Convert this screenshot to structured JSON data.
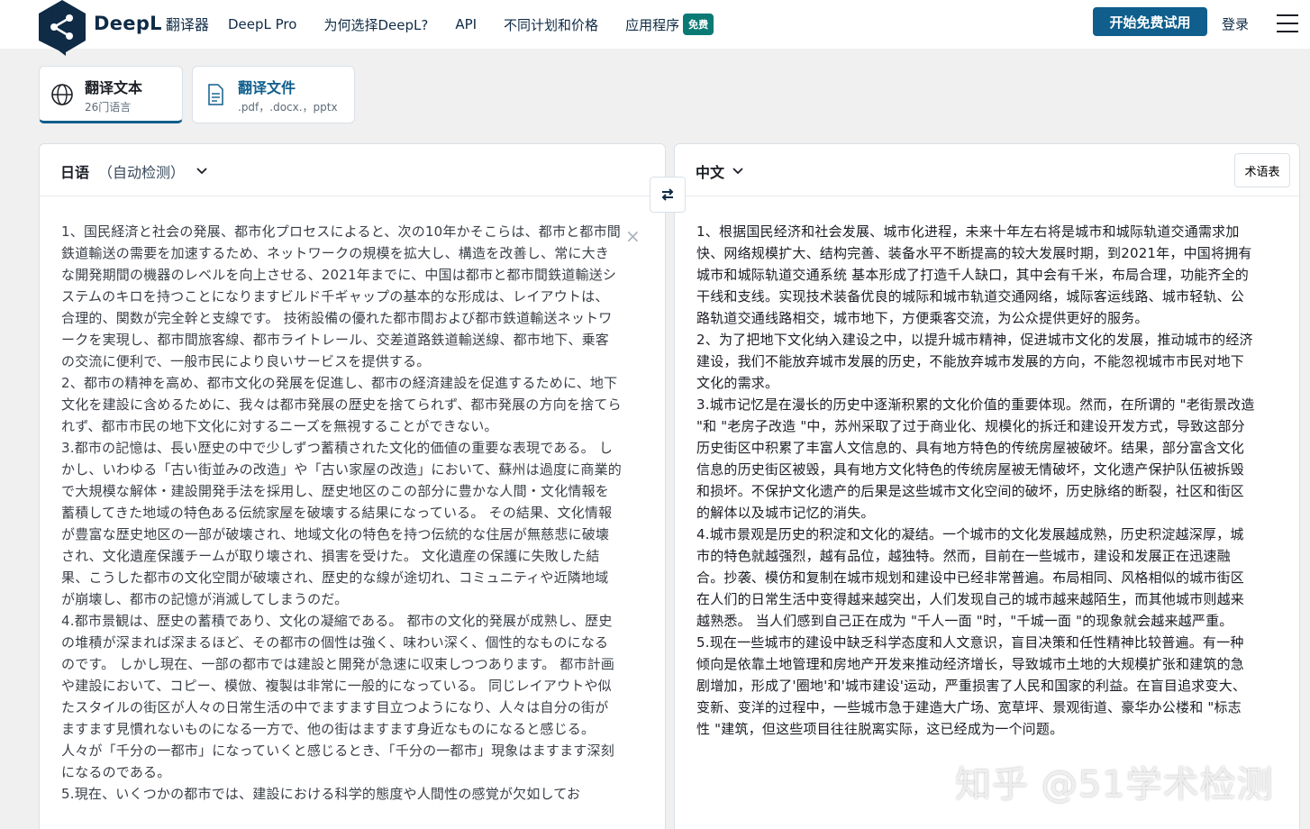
{
  "header": {
    "brand_name": "DeepL",
    "brand_sub": "翻译器",
    "nav": [
      {
        "label": "DeepL Pro"
      },
      {
        "label": "为何选择DeepL?"
      },
      {
        "label": "API"
      },
      {
        "label": "不同计划和价格"
      },
      {
        "label": "应用程序",
        "badge": "免费"
      }
    ],
    "cta_label": "开始免费试用",
    "login_label": "登录"
  },
  "modes": {
    "text": {
      "title": "翻译文本",
      "subtitle": "26门语言",
      "icon": "globe-icon"
    },
    "file": {
      "title": "翻译文件",
      "subtitle": ".pdf，.docx.，pptx",
      "icon": "document-icon"
    }
  },
  "source": {
    "language": "日语",
    "detect_label": "（自动检测）",
    "clear_symbol": "×",
    "paragraphs": [
      "1、国民経済と社会の発展、都市化プロセスによると、次の10年かそこらは、都市と都市間鉄道輸送の需要を加速するため、ネットワークの規模を拡大し、構造を改善し、常に大きな開発期間の機器のレベルを向上させる、2021年までに、中国は都市と都市間鉄道輸送システムのキロを持つことになりますビルド千ギャップの基本的な形成は、レイアウトは、合理的、関数が完全幹と支線です。 技術設備の優れた都市間および都市鉄道輸送ネットワークを実現し、都市間旅客線、都市ライトレール、交差道路鉄道輸送線、都市地下、乗客の交流に便利で、一般市民により良いサービスを提供する。",
      "2、都市の精神を高め、都市文化の発展を促進し、都市の経済建設を促進するために、地下文化を建設に含めるために、我々は都市発展の歴史を捨てられず、都市発展の方向を捨てられず、都市市民の地下文化に対するニーズを無視することができない。",
      "3.都市の記憶は、長い歴史の中で少しずつ蓄積された文化的価値の重要な表現である。 しかし、いわゆる「古い街並みの改造」や「古い家屋の改造」において、蘇州は過度に商業的で大規模な解体・建設開発手法を採用し、歴史地区のこの部分に豊かな人間・文化情報を蓄積してきた地域の特色ある伝統家屋を破壊する結果になっている。 その結果、文化情報が豊富な歴史地区の一部が破壊され、地域文化の特色を持つ伝統的な住居が無慈悲に破壊され、文化遺産保護チームが取り壊され、損害を受けた。 文化遺産の保護に失敗した結果、こうした都市の文化空間が破壊され、歴史的な線が途切れ、コミュニティや近隣地域が崩壊し、都市の記憶が消滅してしまうのだ。",
      "4.都市景観は、歴史の蓄積であり、文化の凝縮である。 都市の文化的発展が成熟し、歴史の堆積が深まれば深まるほど、その都市の個性は強く、味わい深く、個性的なものになるのです。 しかし現在、一部の都市では建設と開発が急速に収束しつつあります。 都市計画や建設において、コピー、模倣、複製は非常に一般的になっている。 同じレイアウトや似たスタイルの街区が人々の日常生活の中でますます目立つようになり、人々は自分の街がますます見慣れないものになる一方で、他の街はますます身近なものになると感じる。人々が「千分の一都市」になっていくと感じるとき、「千分の一都市」現象はますます深刻になるのである。",
      "5.現在、いくつかの都市では、建設における科学的態度や人間性の感覚が欠如してお"
    ]
  },
  "target": {
    "language": "中文",
    "glossary_label": "术语表",
    "paragraphs": [
      "1、根据国民经济和社会发展、城市化进程，未来十年左右将是城市和城际轨道交通需求加快、网络规模扩大、结构完善、装备水平不断提高的较大发展时期，到2021年，中国将拥有城市和城际轨道交通系统 基本形成了打造千人缺口，其中会有千米，布局合理，功能齐全的干线和支线。实现技术装备优良的城际和城市轨道交通网络，城际客运线路、城市轻轨、公路轨道交通线路相交，城市地下，方便乘客交流，为公众提供更好的服务。",
      "2、为了把地下文化纳入建设之中，以提升城市精神，促进城市文化的发展，推动城市的经济建设，我们不能放弃城市发展的历史，不能放弃城市发展的方向，不能忽视城市市民对地下文化的需求。",
      "3.城市记忆是在漫长的历史中逐渐积累的文化价值的重要体现。然而，在所谓的 \"老街景改造 \"和 \"老房子改造 \"中，苏州采取了过于商业化、规模化的拆迁和建设开发方式，导致这部分历史街区中积累了丰富人文信息的、具有地方特色的传统房屋被破坏。结果，部分富含文化信息的历史街区被毁，具有地方文化特色的传统房屋被无情破坏，文化遗产保护队伍被拆毁和损坏。不保护文化遗产的后果是这些城市文化空间的破坏，历史脉络的断裂，社区和街区的解体以及城市记忆的消失。",
      "4.城市景观是历史的积淀和文化的凝结。一个城市的文化发展越成熟，历史积淀越深厚，城市的特色就越强烈，越有品位，越独特。然而，目前在一些城市，建设和发展正在迅速融合。抄袭、模仿和复制在城市规划和建设中已经非常普遍。布局相同、风格相似的城市街区在人们的日常生活中变得越来越突出，人们发现自己的城市越来越陌生，而其他城市则越来越熟悉。 当人们感到自己正在成为 \"千人一面 \"时，\"千城一面 \"的现象就会越来越严重。",
      "5.现在一些城市的建设中缺乏科学态度和人文意识，盲目决策和任性精神比较普遍。有一种倾向是依靠土地管理和房地产开发来推动经济增长，导致城市土地的大规模扩张和建筑的急剧增加，形成了'圈地'和'城市建设'运动，严重损害了人民和国家的利益。在盲目追求变大、变新、变洋的过程中，一些城市急于建造大广场、宽草坪、景观街道、豪华办公楼和 \"标志性 \"建筑，但这些项目往往脱离实际，这已经成为一个问题。"
    ]
  },
  "watermark": "知乎 @51学术检测",
  "colors": {
    "brand": "#0f2b46",
    "primary_button": "#0f5e8c",
    "badge": "#0b7a75",
    "background": "#f0f0f0"
  }
}
